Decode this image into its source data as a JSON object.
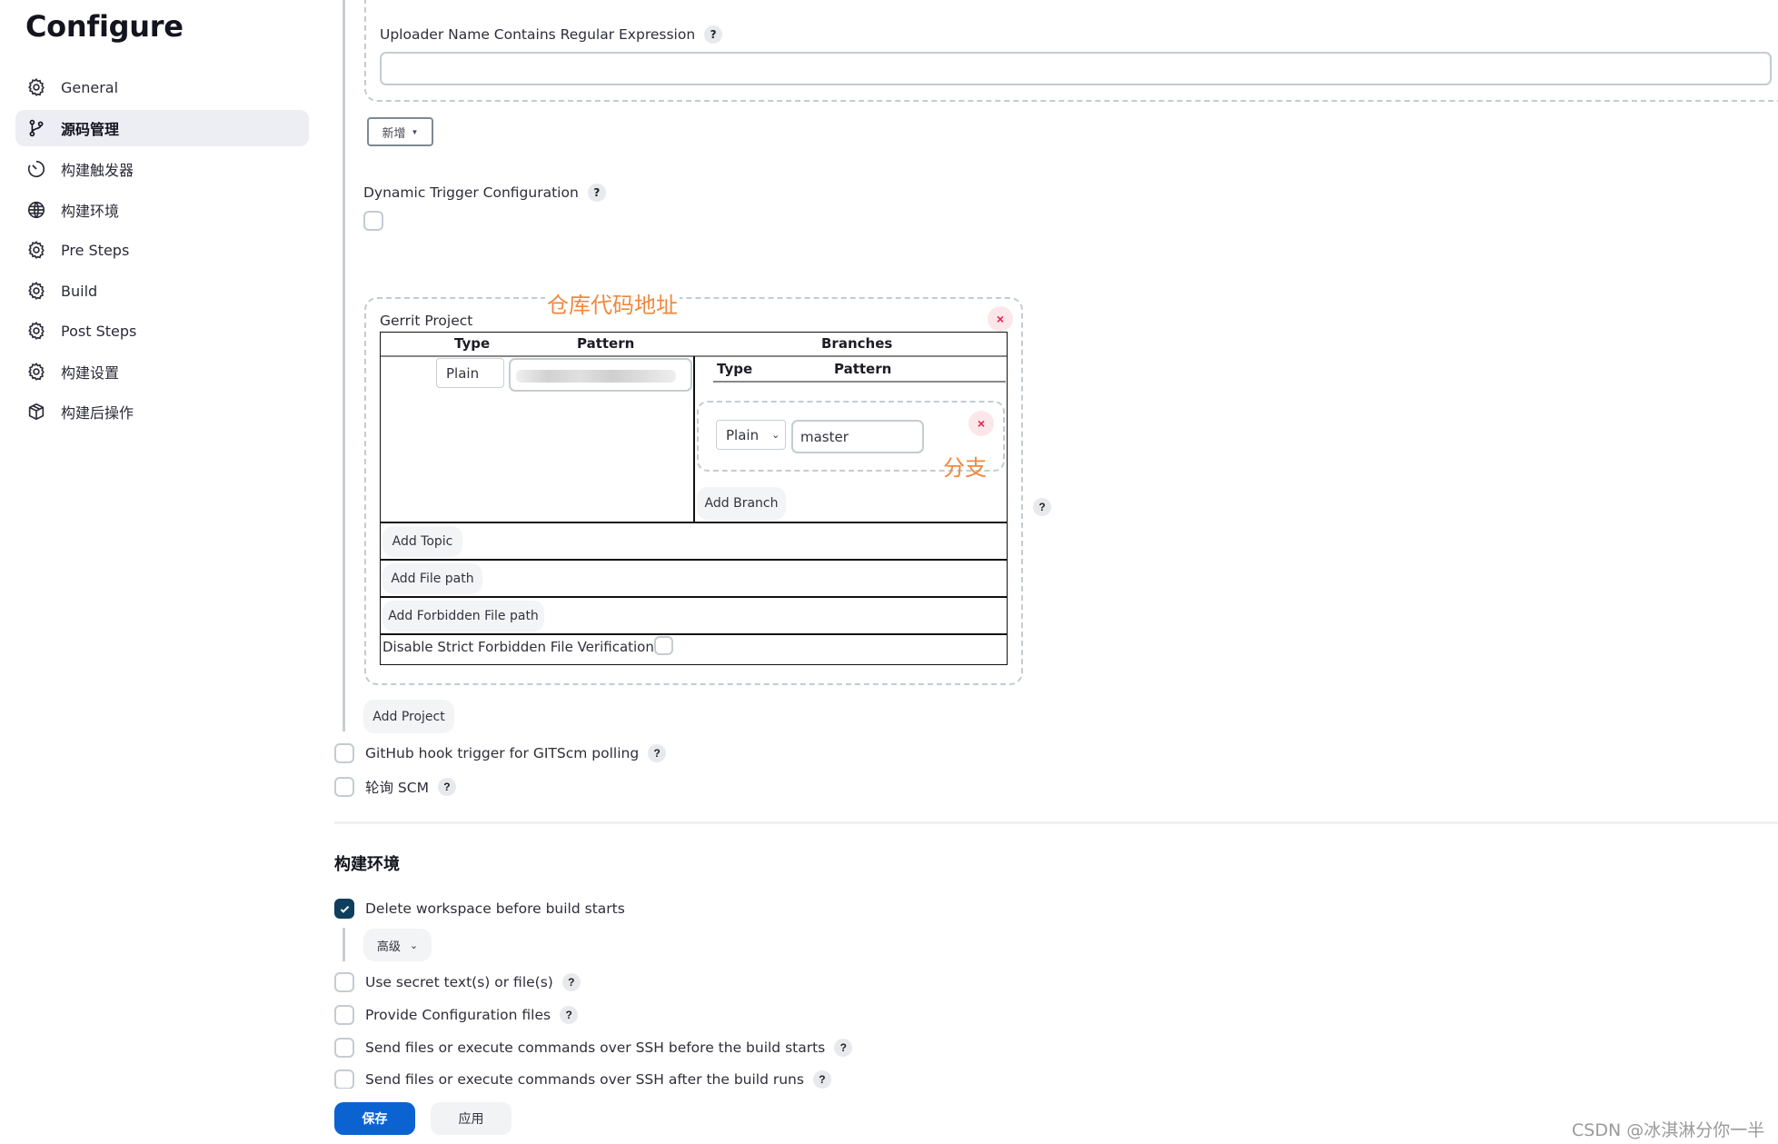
{
  "page": {
    "title": "Configure"
  },
  "sidebar": {
    "items": [
      {
        "label": "General",
        "icon": "gear-icon",
        "active": false
      },
      {
        "label": "源码管理",
        "icon": "branch-icon",
        "active": true
      },
      {
        "label": "构建触发器",
        "icon": "timer-icon",
        "active": false
      },
      {
        "label": "构建环境",
        "icon": "globe-icon",
        "active": false
      },
      {
        "label": "Pre Steps",
        "icon": "gear-icon",
        "active": false
      },
      {
        "label": "Build",
        "icon": "gear-icon",
        "active": false
      },
      {
        "label": "Post Steps",
        "icon": "gear-icon",
        "active": false
      },
      {
        "label": "构建设置",
        "icon": "gear-icon",
        "active": false
      },
      {
        "label": "构建后操作",
        "icon": "package-icon",
        "active": false
      }
    ]
  },
  "trigger": {
    "uploader_label": "Uploader Name Contains Regular Expression",
    "uploader_value": "",
    "add_button": "新增",
    "dynamic_label": "Dynamic Trigger Configuration",
    "dynamic_checked": false
  },
  "gerrit": {
    "section_label": "Gerrit Project",
    "annotation_repo": "仓库代码地址",
    "annotation_branch": "分支",
    "headers": {
      "type": "Type",
      "pattern": "Pattern",
      "branches": "Branches"
    },
    "project": {
      "type": "Plain",
      "pattern": "(redacted)"
    },
    "branch_headers": {
      "type": "Type",
      "pattern": "Pattern"
    },
    "branch": {
      "type": "Plain",
      "pattern": "master"
    },
    "remove_glyph": "×",
    "add_branch": "Add Branch",
    "add_topic": "Add Topic",
    "add_file_path": "Add File path",
    "add_forbidden": "Add Forbidden File path",
    "disable_strict": "Disable Strict Forbidden File Verification",
    "disable_strict_checked": false,
    "add_project": "Add Project"
  },
  "triggers_extra": [
    {
      "label": "GitHub hook trigger for GITScm polling",
      "checked": false
    },
    {
      "label": "轮询 SCM",
      "checked": false
    }
  ],
  "build_env": {
    "heading": "构建环境",
    "options": [
      {
        "label": "Delete workspace before build starts",
        "checked": true,
        "help": false
      },
      {
        "label": "Use secret text(s) or file(s)",
        "checked": false,
        "help": true
      },
      {
        "label": "Provide Configuration files",
        "checked": false,
        "help": true
      },
      {
        "label": "Send files or execute commands over SSH before the build starts",
        "checked": false,
        "help": true
      },
      {
        "label": "Send files or execute commands over SSH after the build runs",
        "checked": false,
        "help": true
      }
    ],
    "advanced": "高级"
  },
  "help_glyph": "?",
  "footer": {
    "save": "保存",
    "apply": "应用"
  },
  "watermark": "CSDN @冰淇淋分你一半",
  "colors": {
    "primary": "#0b63d1",
    "checkbox_checked": "#0f3f5c",
    "annotation": "#f0883e",
    "remove": "#e4204b"
  }
}
